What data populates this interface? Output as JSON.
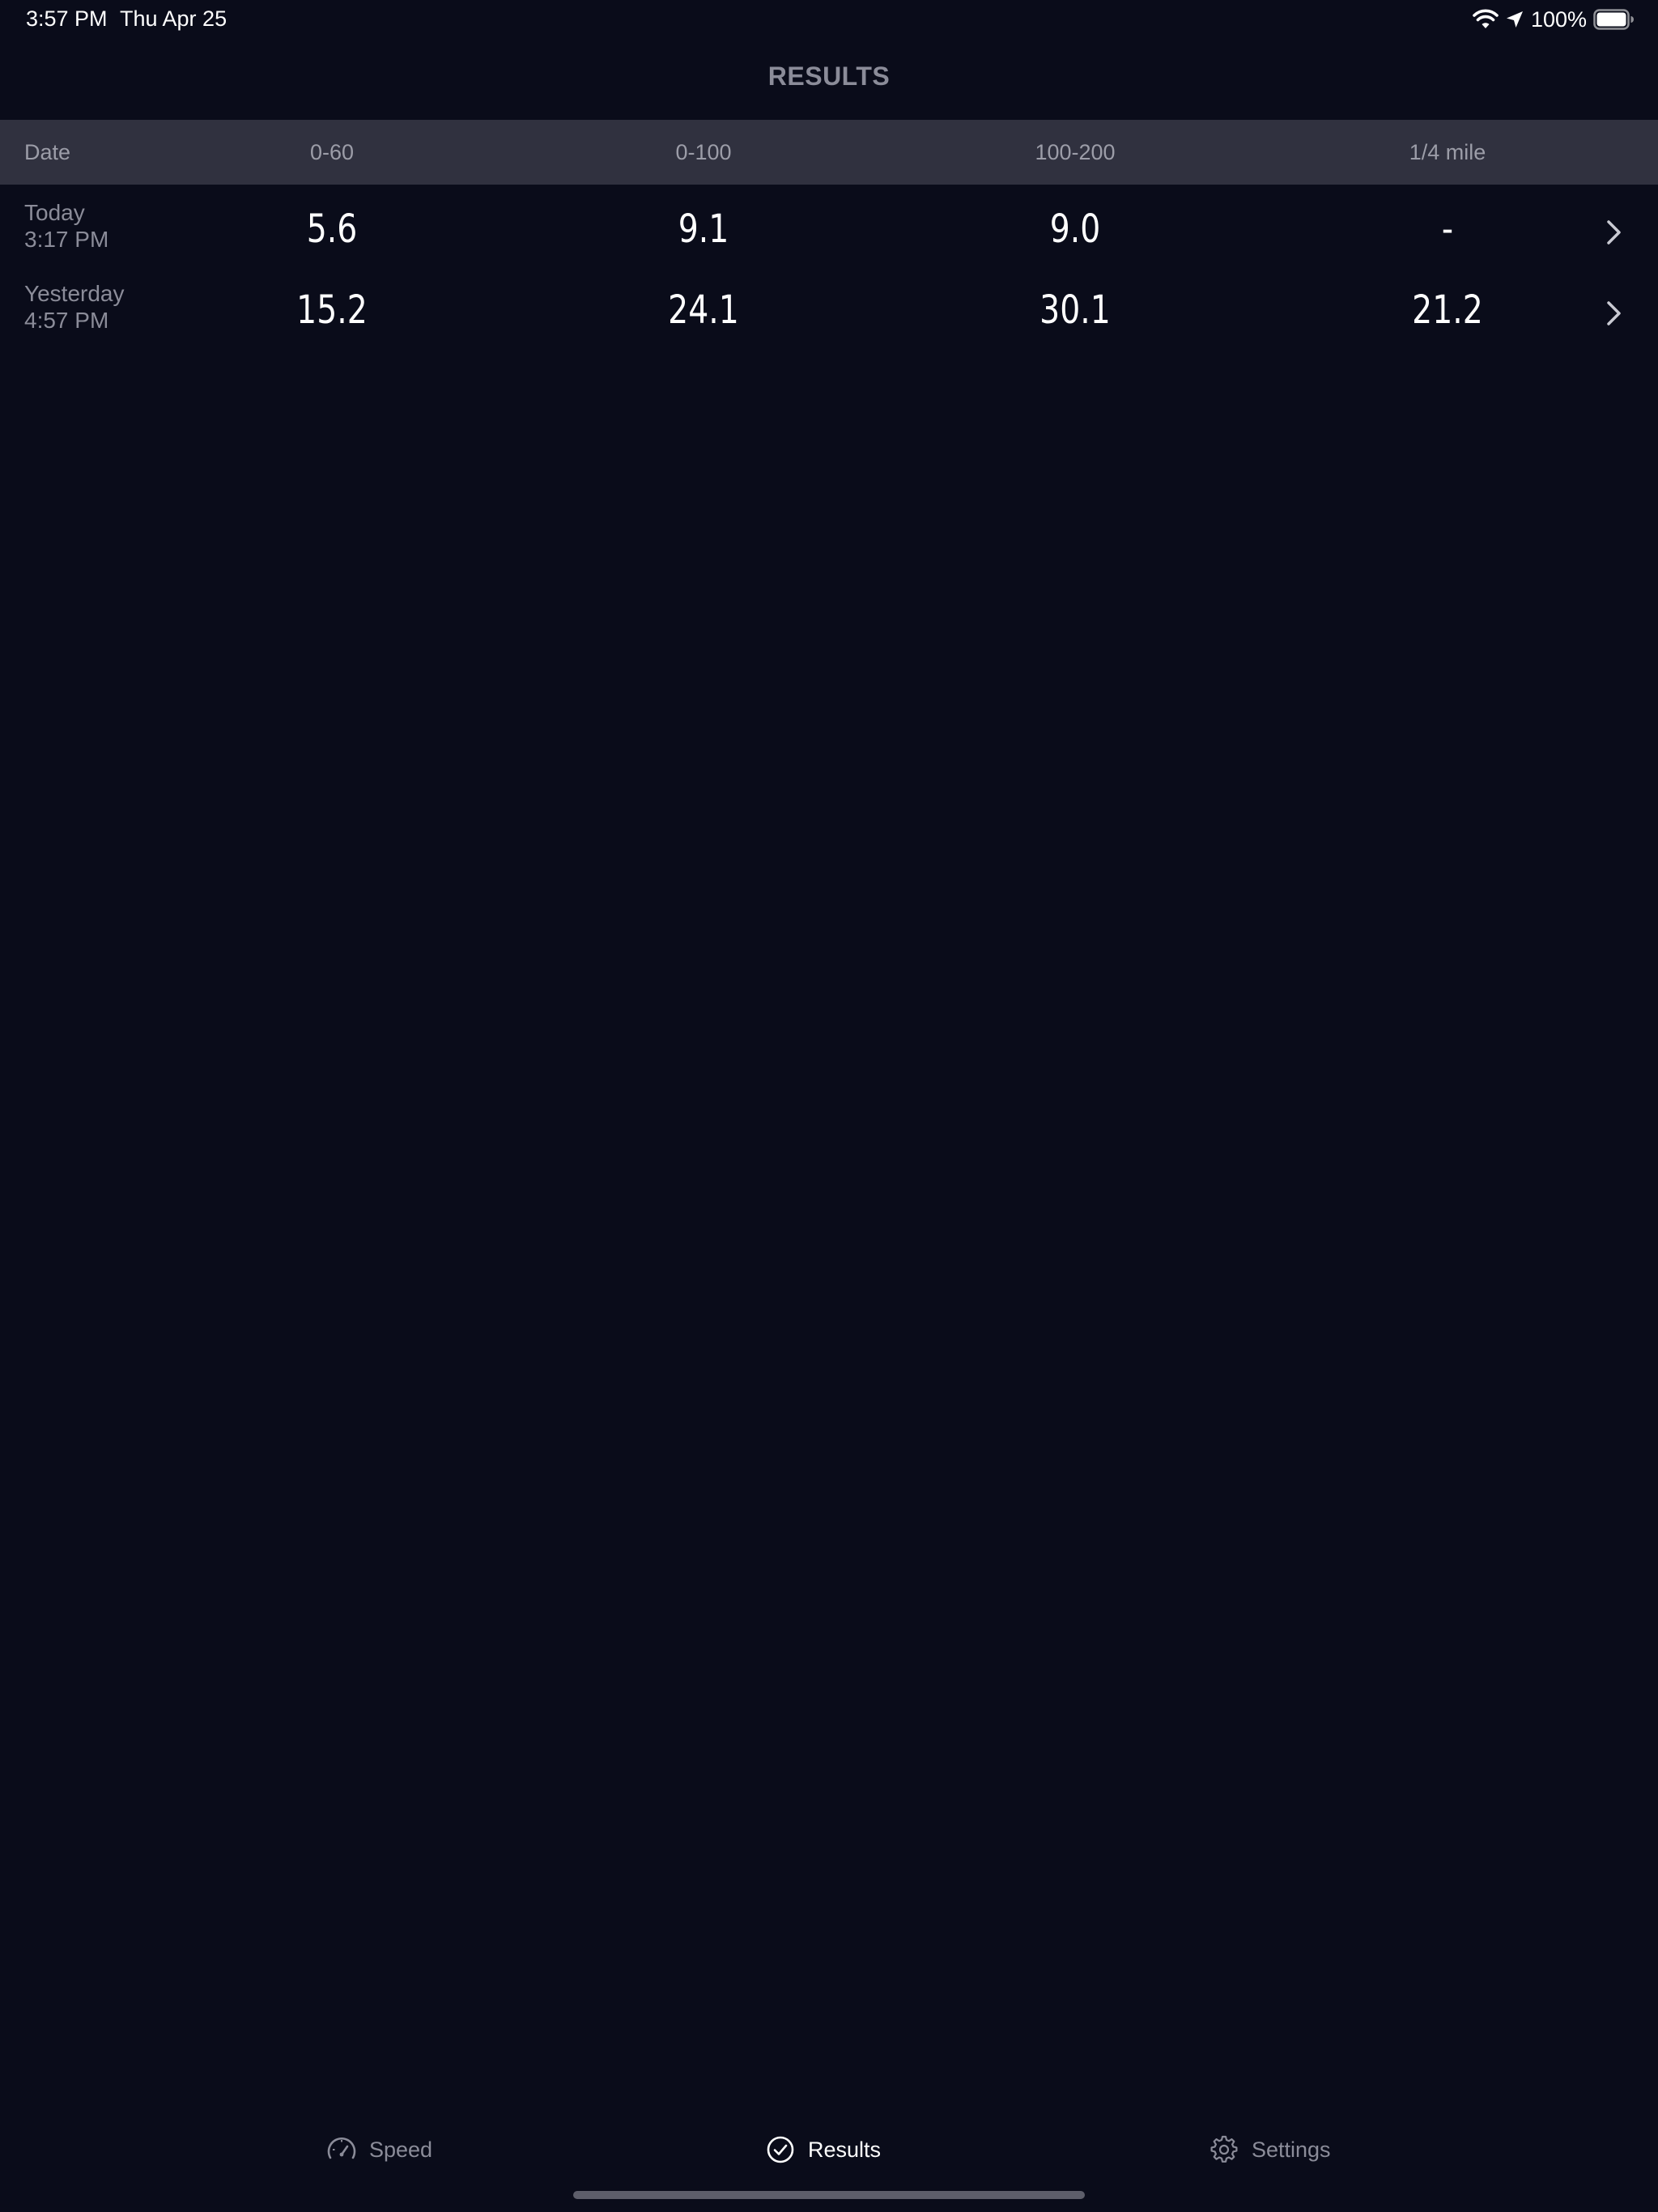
{
  "status_bar": {
    "time": "3:57 PM",
    "date": "Thu Apr 25",
    "battery_percent": "100%",
    "icons": [
      "wifi-icon",
      "location-arrow-icon",
      "battery-icon"
    ]
  },
  "nav": {
    "title": "RESULTS"
  },
  "table": {
    "headers": [
      "Date",
      "0-60",
      "0-100",
      "100-200",
      "1/4 mile"
    ],
    "rows": [
      {
        "date_line1": "Today",
        "date_line2": "3:17 PM",
        "values": [
          "5.6",
          "9.1",
          "9.0",
          "-"
        ]
      },
      {
        "date_line1": "Yesterday",
        "date_line2": "4:57 PM",
        "values": [
          "15.2",
          "24.1",
          "30.1",
          "21.2"
        ]
      }
    ]
  },
  "tab_bar": {
    "active": "Results",
    "tabs": [
      {
        "label": "Speed",
        "icon": "speedometer-icon"
      },
      {
        "label": "Results",
        "icon": "checkmark-circle-icon"
      },
      {
        "label": "Settings",
        "icon": "gear-icon"
      }
    ]
  },
  "colors": {
    "background": "#0a0c1a",
    "header_bar": "#30313f",
    "muted_text": "#8b8c99",
    "primary_text": "#ffffff"
  }
}
